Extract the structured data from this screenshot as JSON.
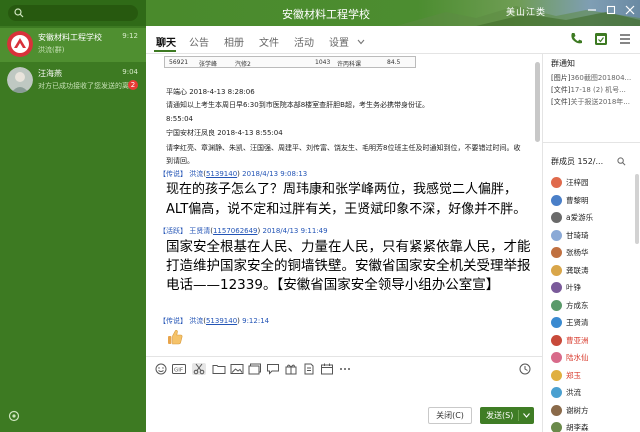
{
  "window": {
    "title": "安徽材料工程学校",
    "stamp": "美山江类"
  },
  "sidebar": {
    "chats": [
      {
        "name": "安徽材料工程学校",
        "subtitle": "洪流(群)",
        "time": "9:12",
        "badge": ""
      },
      {
        "name": "汪海燕",
        "subtitle": "对方已成功接收了您发送的离线文件",
        "time": "9:04",
        "badge": "2"
      }
    ]
  },
  "tabs": [
    "聊天",
    "公告",
    "相册",
    "文件",
    "活动",
    "设置"
  ],
  "image_strip": {
    "left_id": "56921",
    "left_name": "张学峰",
    "left_extra": "汽修2",
    "right_id": "1043",
    "right_name": "许丙科课",
    "right_score": "84.5"
  },
  "notices": [
    "平端心 2018-4-13 8:28:06",
    "请通知以上考生本周日早6:30到市医院本部8楼室查肝胆B超，考生务必携带身份证。",
    "8:55:04",
    "宁国安材汪凤良 2018-4-13 8:55:04",
    "请李红亮、章渊静、朱凯、汪国强、周建平、刘传富、饶友生、毛明芳8位班主任及时通知到位，不要错过时间。收到请回。"
  ],
  "messages": [
    {
      "role": "【传说】",
      "sender": "洪流",
      "qq": "5139140",
      "time": "2018/4/13 9:08:13",
      "text": "现在的孩子怎么了？周玮康和张学峰两位，我感觉二人偏胖，ALT偏高，说不定和过胖有关，王贤斌印象不深，好像并不胖。"
    },
    {
      "role": "【活跃】",
      "sender": "王贤清",
      "qq": "1157062649",
      "time": "2018/4/13 9:11:49",
      "text": "国家安全根基在人民、力量在人民，只有紧紧依靠人民，才能打造维护国家安全的铜墙铁壁。安徽省国家安全机关受理举报电话——12339。【安徽省国家安全领导小组办公室宣】"
    },
    {
      "role": "【传说】",
      "sender": "洪流",
      "qq": "5139140",
      "time": "9:12:14",
      "text": ""
    }
  ],
  "toolbar_icons": [
    "smile-icon",
    "gif-icon",
    "scissors-icon",
    "folder-icon",
    "image-icon",
    "gallery-icon",
    "chat-bubble-icon",
    "gift-icon",
    "document-icon",
    "calendar-icon",
    "more-icon",
    "history-icon"
  ],
  "buttons": {
    "close": "关闭(C)",
    "send": "发送(S)"
  },
  "right_panel": {
    "notice_title": "群通知",
    "notice_items": [
      {
        "tag": "[图片]",
        "text": "360截图201804..."
      },
      {
        "tag": "[文件]",
        "text": "17-18 (2) 机号..."
      },
      {
        "tag": "[文件]",
        "text": "关于报送2018年..."
      }
    ],
    "members_title": "群成员 152/...",
    "members": [
      {
        "name": "汪梓园",
        "red": false,
        "color": "#e06a4c"
      },
      {
        "name": "曹黎明",
        "red": false,
        "color": "#4a7fc8"
      },
      {
        "name": "a爱游乐",
        "red": false,
        "color": "#6a6a6a"
      },
      {
        "name": "甘琦琦",
        "red": false,
        "color": "#8aa9d6"
      },
      {
        "name": "张杨华",
        "red": false,
        "color": "#c07040"
      },
      {
        "name": "龚联涛",
        "red": false,
        "color": "#d9a64a"
      },
      {
        "name": "叶铮",
        "red": false,
        "color": "#7a5a9a"
      },
      {
        "name": "方成东",
        "red": false,
        "color": "#5a9a6a"
      },
      {
        "name": "王贤清",
        "red": false,
        "color": "#3a8ad0"
      },
      {
        "name": "曹亚洲",
        "red": true,
        "color": "#c84a3a"
      },
      {
        "name": "陆水仙",
        "red": true,
        "color": "#d86a8a"
      },
      {
        "name": "郑玉",
        "red": true,
        "color": "#e0b040"
      },
      {
        "name": "洪流",
        "red": false,
        "color": "#4aa0d0"
      },
      {
        "name": "谢树方",
        "red": false,
        "color": "#8a6a4a"
      },
      {
        "name": "胡李森",
        "red": false,
        "color": "#6a8a4a"
      }
    ]
  },
  "colors": {
    "brand": "#3d7a22",
    "link": "#2455b6",
    "badge": "#e83a35",
    "admin_red": "#d83a2c"
  }
}
